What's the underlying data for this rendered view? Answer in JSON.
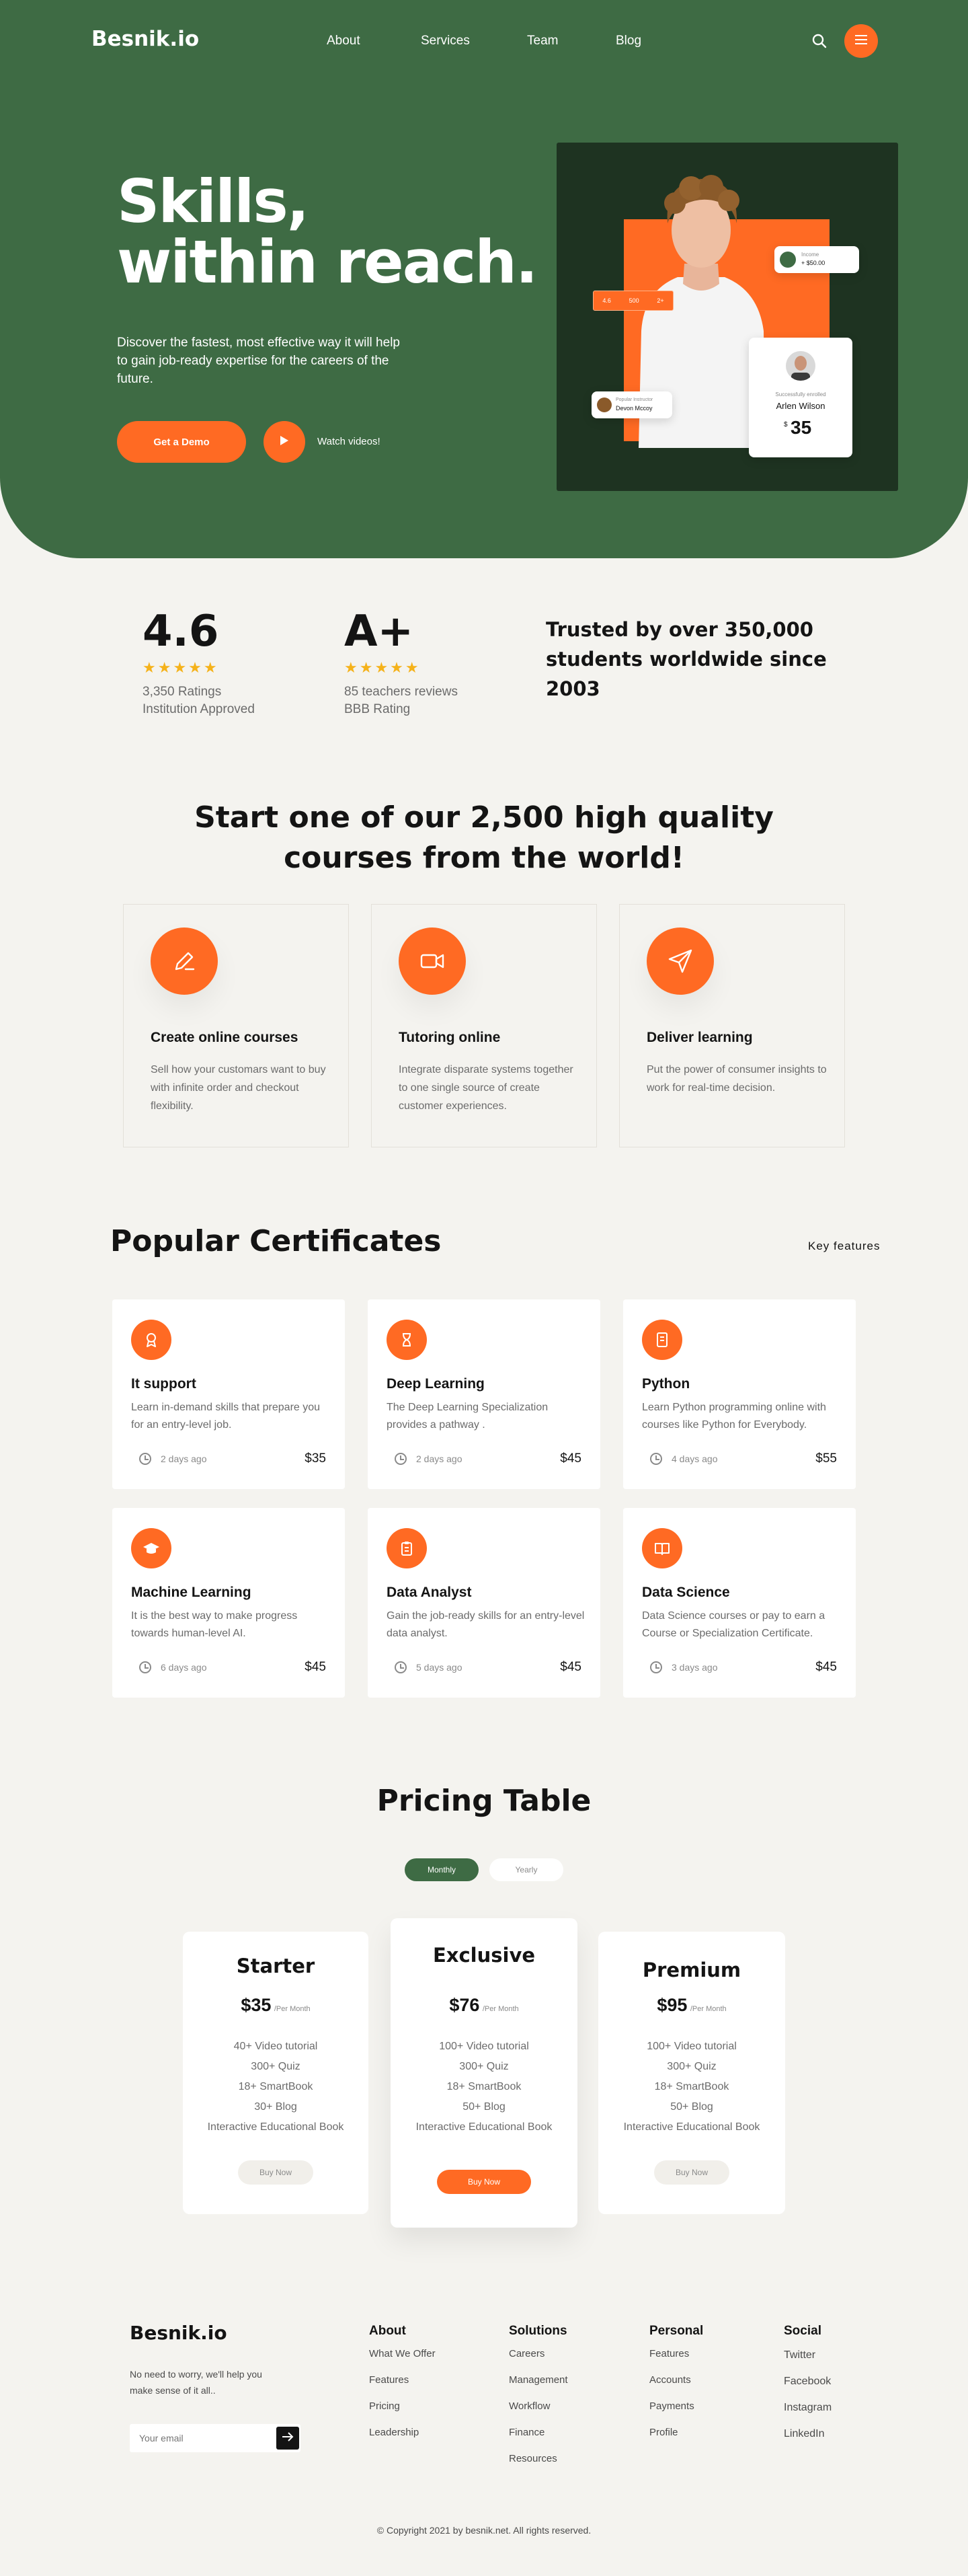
{
  "header": {
    "logo": "Besnik.io",
    "nav": [
      "About",
      "Services",
      "Team",
      "Blog"
    ],
    "search_icon": "search-icon",
    "menu_icon": "menu-icon"
  },
  "hero": {
    "title_line1": "Skills,",
    "title_line2": "within reach.",
    "subtitle": "Discover the fastest, most effective way it will help to gain job-ready expertise for the careers of the future.",
    "demo_button": "Get a Demo",
    "watch_label": "Watch videos!",
    "badge_income_label": "Income",
    "badge_income_value": "+ $50.00",
    "chip_a": "4.6",
    "chip_b": "500",
    "chip_c": "2+",
    "enrolled_label": "Popular Instructor",
    "enrolled_name": "Devon Mccoy",
    "success_label": "Successfully enrolled",
    "success_name": "Arlen Wilson",
    "success_currency": "$",
    "success_amount": "35",
    "accent_color": "#ff6a23",
    "hero_color": "#3e6b44",
    "photo_bg": "#1e3321"
  },
  "stats": {
    "rating_value": "4.6",
    "rating_line1": "3,350 Ratings",
    "rating_line2": "Institution Approved",
    "grade_value": "A+",
    "grade_line1": "85 teachers reviews",
    "grade_line2": "BBB Rating",
    "stars": "★★★★★",
    "trusted": "Trusted by over 350,000 students worldwide since 2003"
  },
  "courses": {
    "title_line1": "Start one of our 2,500 high quality",
    "title_line2": "courses from the world!",
    "features": [
      {
        "title": "Create online courses",
        "desc": "Sell how your customars want to buy with infinite order and checkout flexibility.",
        "icon": "pencil-icon"
      },
      {
        "title": "Tutoring online",
        "desc": "Integrate disparate systems together to one single source of create customer experiences.",
        "icon": "video-camera-icon"
      },
      {
        "title": "Deliver learning",
        "desc": "Put the power of consumer insights to work for real-time decision.",
        "icon": "send-icon"
      }
    ]
  },
  "certificates": {
    "title": "Popular Certificates",
    "key_features": "Key features",
    "items": [
      {
        "title": "It support",
        "desc": "Learn in-demand skills that prepare you for an entry-level job.",
        "date": "2 days ago",
        "price": "$35",
        "icon": "award-icon"
      },
      {
        "title": "Deep Learning",
        "desc": "The Deep Learning Specialization provides a pathway .",
        "date": "2 days ago",
        "price": "$45",
        "icon": "hourglass-icon"
      },
      {
        "title": "Python",
        "desc": "Learn Python programming online with courses like Python for Everybody.",
        "date": "4 days ago",
        "price": "$55",
        "icon": "document-icon"
      },
      {
        "title": "Machine Learning",
        "desc": "It is the best way to make progress towards human-level AI.",
        "date": "6 days ago",
        "price": "$45",
        "icon": "graduation-cap-icon"
      },
      {
        "title": "Data Analyst",
        "desc": "Gain the job-ready skills for an entry-level data analyst.",
        "date": "5 days ago",
        "price": "$45",
        "icon": "clipboard-icon"
      },
      {
        "title": "Data Science",
        "desc": "Data Science courses or pay to earn a Course or Specialization Certificate.",
        "date": "3 days ago",
        "price": "$45",
        "icon": "book-icon"
      }
    ]
  },
  "pricing": {
    "title": "Pricing Table",
    "toggle_monthly": "Monthly",
    "toggle_yearly": "Yearly",
    "per": "/Per Month",
    "plans": [
      {
        "name": "Starter",
        "price": "$35",
        "features": [
          "40+ Video tutorial",
          "300+ Quiz",
          "18+ SmartBook",
          "30+ Blog",
          "Interactive Educational Book"
        ],
        "button": "Buy Now"
      },
      {
        "name": "Exclusive",
        "price": "$76",
        "features": [
          "100+ Video tutorial",
          "300+ Quiz",
          "18+ SmartBook",
          "50+ Blog",
          "Interactive Educational Book"
        ],
        "button": "Buy Now"
      },
      {
        "name": "Premium",
        "price": "$95",
        "features": [
          "100+ Video tutorial",
          "300+ Quiz",
          "18+ SmartBook",
          "50+ Blog",
          "Interactive Educational Book"
        ],
        "button": "Buy Now"
      }
    ]
  },
  "footer": {
    "logo": "Besnik.io",
    "tagline": "No need to worry, we'll help you make sense of it all..",
    "email_placeholder": "Your email",
    "columns": [
      {
        "title": "About",
        "links": [
          "What We Offer",
          "Features",
          "Pricing",
          "Leadership"
        ]
      },
      {
        "title": "Solutions",
        "links": [
          "Careers",
          "Management",
          "Workflow",
          "Finance",
          "Resources"
        ]
      },
      {
        "title": "Personal",
        "links": [
          "Features",
          "Accounts",
          "Payments",
          "Profile"
        ]
      },
      {
        "title": "Social",
        "links": [
          "Twitter",
          "Facebook",
          "Instagram",
          "LinkedIn"
        ]
      }
    ],
    "copyright": "© Copyright 2021 by besnik.net. All rights reserved."
  }
}
